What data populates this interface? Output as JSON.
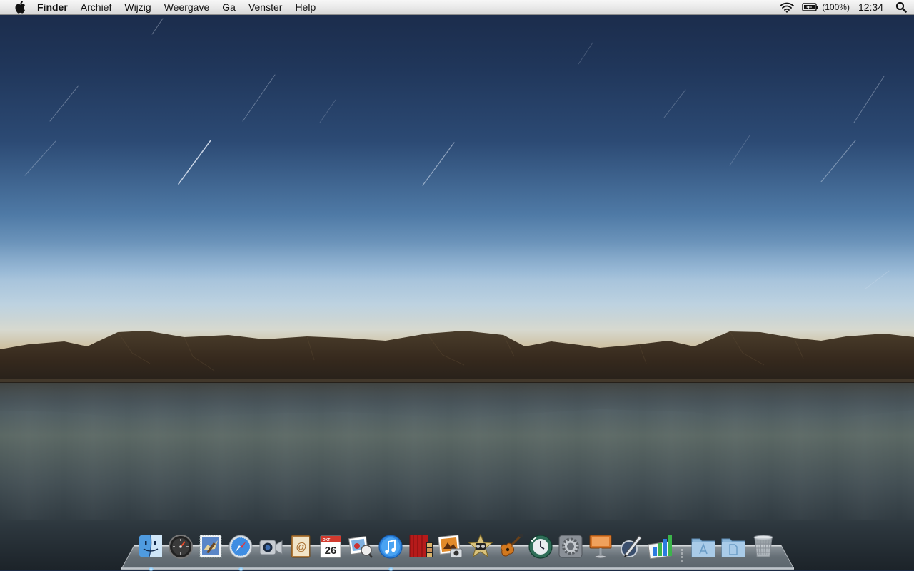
{
  "menubar": {
    "apple_icon": "apple-icon",
    "app_name": "Finder",
    "items": [
      "Archief",
      "Wijzig",
      "Weergave",
      "Ga",
      "Venster",
      "Help"
    ],
    "status": {
      "wifi_icon": "wifi-icon",
      "battery_icon": "battery-charging-icon",
      "battery_percent": "(100%)",
      "clock": "12:34",
      "spotlight_icon": "spotlight-search-icon"
    }
  },
  "desktop": {
    "wallpaper": "night-sky-lake-mountains",
    "colors": {
      "sky_top": "#1a2a48",
      "horizon": "#d7d9cf",
      "mountains": "#3a2f22",
      "water": "#4a5861"
    }
  },
  "dock": {
    "items": [
      {
        "name": "finder",
        "icon": "finder-icon",
        "running": true
      },
      {
        "name": "dashboard",
        "icon": "dashboard-icon",
        "running": false
      },
      {
        "name": "mail",
        "icon": "mail-stamp-icon",
        "running": false
      },
      {
        "name": "safari",
        "icon": "safari-compass-icon",
        "running": true
      },
      {
        "name": "facetime",
        "icon": "facetime-camera-icon",
        "running": false
      },
      {
        "name": "address-book",
        "icon": "address-book-icon",
        "running": false
      },
      {
        "name": "ical",
        "icon": "calendar-icon",
        "running": false,
        "calendar_month": "OKT",
        "calendar_day": "26"
      },
      {
        "name": "photo-booth",
        "icon": "photos-icon",
        "running": false
      },
      {
        "name": "itunes",
        "icon": "itunes-icon",
        "running": true
      },
      {
        "name": "photo-booth-red",
        "icon": "photo-booth-icon",
        "running": false
      },
      {
        "name": "iphoto",
        "icon": "iphoto-icon",
        "running": false
      },
      {
        "name": "imovie",
        "icon": "imovie-star-icon",
        "running": false
      },
      {
        "name": "garageband",
        "icon": "garageband-guitar-icon",
        "running": false
      },
      {
        "name": "time-machine",
        "icon": "time-machine-icon",
        "running": false
      },
      {
        "name": "system-preferences",
        "icon": "system-preferences-gear-icon",
        "running": false
      },
      {
        "name": "keynote",
        "icon": "keynote-podium-icon",
        "running": false
      },
      {
        "name": "pages",
        "icon": "pages-pen-icon",
        "running": false
      },
      {
        "name": "numbers",
        "icon": "numbers-chart-icon",
        "running": false
      }
    ],
    "stacks": [
      {
        "name": "applications-folder",
        "icon": "applications-folder-icon"
      },
      {
        "name": "documents-folder",
        "icon": "documents-folder-icon"
      },
      {
        "name": "trash",
        "icon": "trash-icon"
      }
    ]
  }
}
